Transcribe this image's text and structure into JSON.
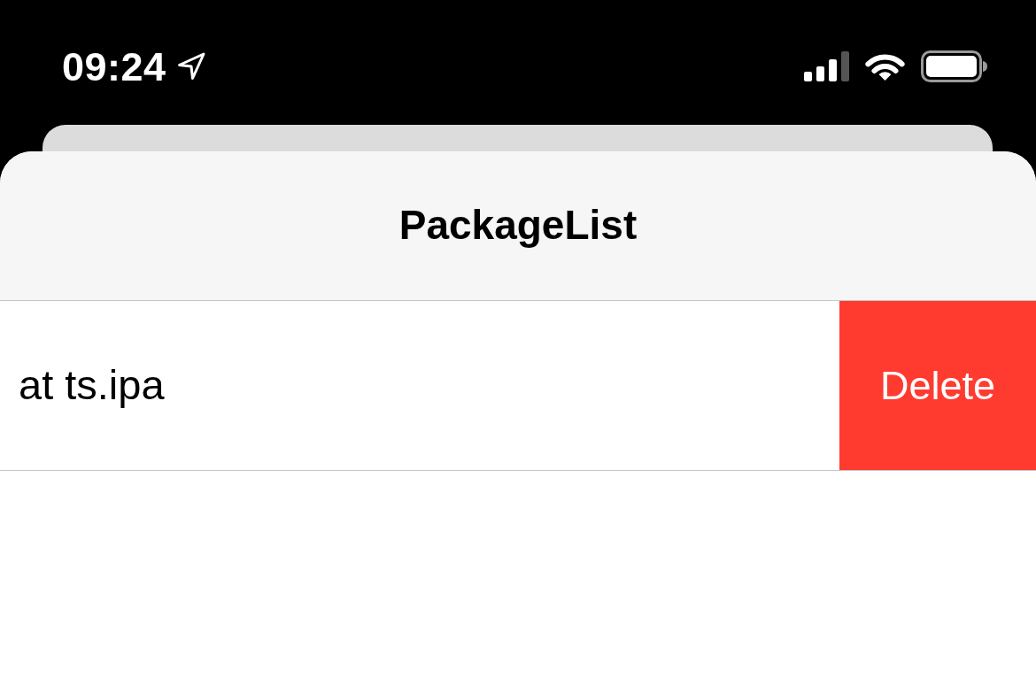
{
  "status_bar": {
    "time": "09:24"
  },
  "sheet": {
    "title": "PackageList"
  },
  "rows": [
    {
      "name": "at ts.ipa",
      "actions": [
        {
          "label": "Delete",
          "kind": "destructive"
        }
      ]
    }
  ]
}
